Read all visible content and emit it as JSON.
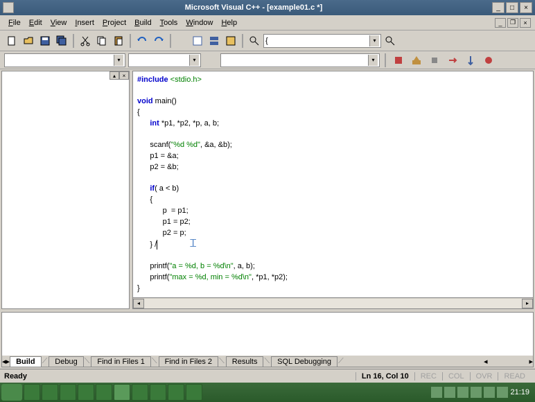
{
  "title": "Microsoft Visual C++ - [example01.c *]",
  "menu": [
    "File",
    "Edit",
    "View",
    "Insert",
    "Project",
    "Build",
    "Tools",
    "Window",
    "Help"
  ],
  "combo_find": "{",
  "code": {
    "l1a": "#include",
    "l1b": " <stdio.h>",
    "l3a": "void",
    "l3b": " main()",
    "l4": "{",
    "l5a": "      int",
    "l5b": " *p1, *p2, *p, a, b;",
    "l7": "      scanf(",
    "l7s": "\"%d %d\"",
    "l7b": ", &a, &b);",
    "l8": "      p1 = &a;",
    "l9": "      p2 = &b;",
    "l11a": "      if",
    "l11b": "( a < b)",
    "l12": "      {",
    "l13": "            p  = p1;",
    "l14": "            p1 = p2;",
    "l15": "            p2 = p;",
    "l16": "      } /",
    "l18": "      printf(",
    "l18s": "\"a = %d, b = %d\\n\"",
    "l18b": ", a, b);",
    "l19": "      printf(",
    "l19s": "\"max = %d, min = %d\\n\"",
    "l19b": ", *p1, *p2);",
    "l20": "}"
  },
  "tabs": [
    "Build",
    "Debug",
    "Find in Files 1",
    "Find in Files 2",
    "Results",
    "SQL Debugging"
  ],
  "status": {
    "ready": "Ready",
    "pos": "Ln 16, Col 10",
    "ind": [
      "REC",
      "COL",
      "OVR",
      "READ"
    ]
  },
  "clock": "21:19"
}
